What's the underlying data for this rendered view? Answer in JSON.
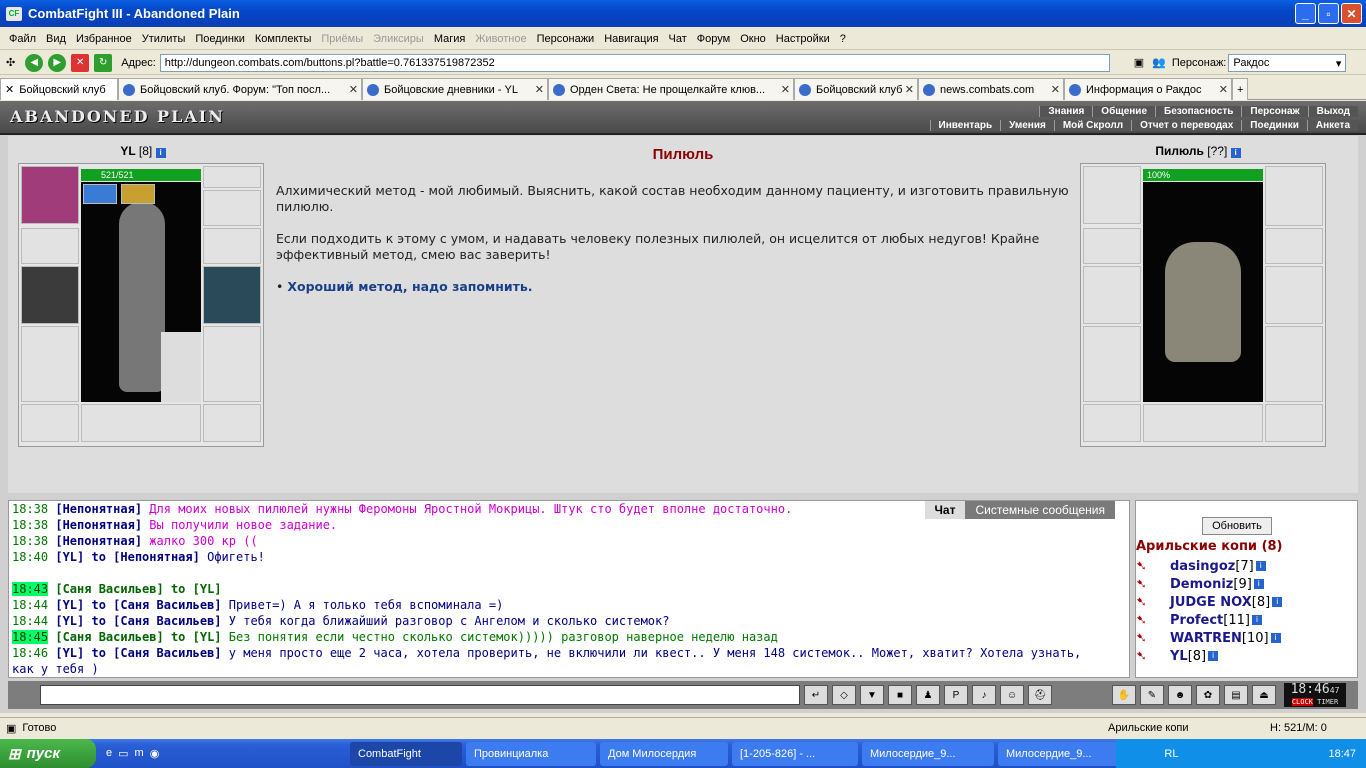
{
  "window": {
    "title": "CombatFight III - Abandoned Plain",
    "app_icon": "CF"
  },
  "menu": [
    "Файл",
    "Вид",
    "Избранное",
    "Утилиты",
    "Поединки",
    "Комплекты",
    "Приёмы",
    "Эликсиры",
    "Магия",
    "Животное",
    "Персонажи",
    "Навигация",
    "Чат",
    "Форум",
    "Окно",
    "Настройки",
    "?"
  ],
  "menu_disabled": [
    "Приёмы",
    "Эликсиры",
    "Животное"
  ],
  "address": {
    "label": "Адрес:",
    "url": "http://dungeon.combats.com/buttons.pl?battle=0.761337519872352",
    "person_label": "Персонаж:",
    "person_value": "Ракдос"
  },
  "tabs": [
    {
      "label": "Бойцовский клуб"
    },
    {
      "label": "Бойцовский клуб. Форум: \"Топ посл..."
    },
    {
      "label": "Бойцовские дневники - YL"
    },
    {
      "label": "Орден Света: Не прощелкайте клюв..."
    },
    {
      "label": "Бойцовский клуб"
    },
    {
      "label": "news.combats.com"
    },
    {
      "label": "Информация о Ракдос"
    }
  ],
  "header": {
    "logo": "ABANDONED PLAIN",
    "nav_top": [
      "Знания",
      "Общение",
      "Безопасность",
      "Персонаж",
      "Выход"
    ],
    "nav_bottom": [
      "Инвентарь",
      "Умения",
      "Мой Скролл",
      "Отчет о переводах",
      "Поединки",
      "Анкета"
    ]
  },
  "player": {
    "name": "YL",
    "level": "[8]",
    "hp": "521/521",
    "hp_fraction": 1.0
  },
  "npc": {
    "name": "Пилюль",
    "level": "[??]",
    "hp": "100%",
    "hp_fraction": 1.0
  },
  "quest": {
    "title": "Пилюль",
    "p1": "Алхимический метод - мой любимый. Выяснить, какой состав необходим данному пациенту, и изготовить правильную пилюлю.",
    "p2": "Если подходить к этому с умом, и надавать человеку полезных пилюлей, он исцелится от любых недугов! Крайне эффективный метод, смею вас заверить!",
    "option": "Хороший метод, надо запомнить."
  },
  "chat": {
    "tabs": [
      "Чат",
      "Системные сообщения"
    ],
    "lines": [
      {
        "time": "18:38",
        "who": "[Непонятная]",
        "text": "Для моих новых пилюлей нужны Феромоны Яростной Мокрицы. Штук сто будет вполне достаточно.",
        "kind": "sys"
      },
      {
        "time": "18:38",
        "who": "[Непонятная]",
        "text": "Вы получили новое задание.",
        "kind": "sys"
      },
      {
        "time": "18:38",
        "who": "[Непонятная]",
        "text": "жалко 300 кр ((",
        "kind": "sys"
      },
      {
        "time": "18:40",
        "who": "[YL] to [Непонятная]",
        "text": "Офигеть!",
        "kind": "pm"
      },
      {
        "time": "",
        "who": "",
        "text": "",
        "kind": "blank"
      },
      {
        "time": "18:43",
        "who": "[Саня Васильев] to [YL]",
        "text": "",
        "kind": "grn",
        "hl": true
      },
      {
        "time": "18:44",
        "who": "[YL] to [Саня Васильев]",
        "text": "Привет=) А я только тебя вспоминала =)",
        "kind": "pm"
      },
      {
        "time": "18:44",
        "who": "[YL] to [Саня Васильев]",
        "text": "У тебя когда ближайший разговор с Ангелом и сколько системок?",
        "kind": "pm"
      },
      {
        "time": "18:45",
        "who": "[Саня Васильев] to [YL]",
        "text": "Без понятия если честно сколько системок))))) разговор наверное неделю назад",
        "kind": "grn",
        "hl": true
      },
      {
        "time": "18:46",
        "who": "[YL] to [Саня Васильев]",
        "text": "у меня просто еще 2 часа, хотела проверить, не включили ли квест.. У меня 148 системок.. Может, хватит? Хотела узнать,",
        "kind": "pm"
      },
      {
        "time": "",
        "who": "",
        "text": "как у тебя )",
        "kind": "pm"
      }
    ]
  },
  "online": {
    "refresh": "Обновить",
    "location": "Арильские копи (8)",
    "users": [
      {
        "nick": "dasingoz",
        "level": "[7]"
      },
      {
        "nick": "Demoniz",
        "level": "[9]"
      },
      {
        "nick": "JUDGE NOX",
        "level": "[8]"
      },
      {
        "nick": "Profect",
        "level": "[11]"
      },
      {
        "nick": "WARTREN",
        "level": "[10]"
      },
      {
        "nick": "YL",
        "level": "[8]"
      }
    ]
  },
  "clock": {
    "time": "18:46",
    "sec": "47",
    "label1": "CLOCK",
    "label2": "TIMER"
  },
  "status": {
    "text": "Готово",
    "location": "Арильские копи",
    "hp": "H: 521/M: 0"
  },
  "taskbar": {
    "start": "пуск",
    "tasks": [
      "CombatFight",
      "Провинциалка",
      "Дом Милосердия",
      "[1-205-826] - ...",
      "Милосердие_9...",
      "Милосердие_9..."
    ],
    "lang": "RL",
    "time": "18:47"
  }
}
